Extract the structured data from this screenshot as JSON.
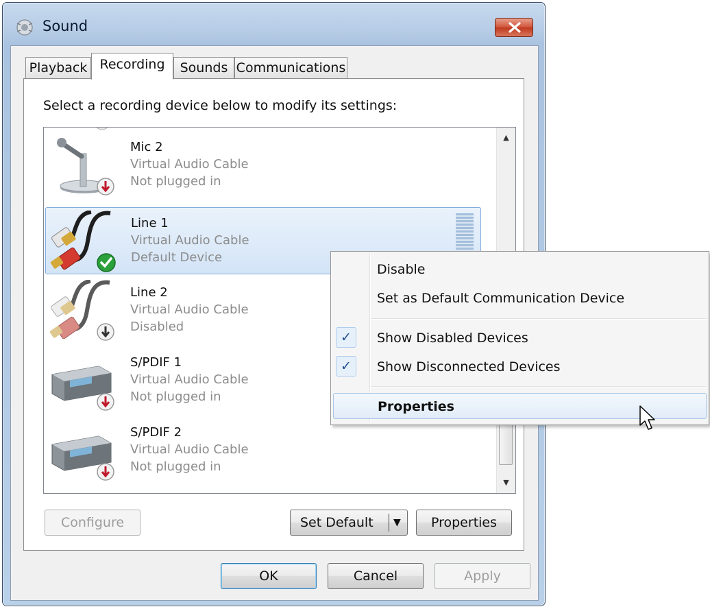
{
  "window": {
    "title": "Sound"
  },
  "tabs": [
    {
      "label": "Playback"
    },
    {
      "label": "Recording"
    },
    {
      "label": "Sounds"
    },
    {
      "label": "Communications"
    }
  ],
  "active_tab": "Recording",
  "instruction": "Select a recording device below to modify its settings:",
  "devices": [
    {
      "name": "Mic 2",
      "driver": "Virtual Audio Cable",
      "status": "Not plugged in",
      "icon": "microphone-icon",
      "badge": "red-down-arrow"
    },
    {
      "name": "Line 1",
      "driver": "Virtual Audio Cable",
      "status": "Default Device",
      "icon": "line-in-cable-icon",
      "badge": "green-check",
      "selected": true
    },
    {
      "name": "Line 2",
      "driver": "Virtual Audio Cable",
      "status": "Disabled",
      "icon": "line-in-cable-icon",
      "badge": "gray-down-arrow"
    },
    {
      "name": "S/PDIF 1",
      "driver": "Virtual Audio Cable",
      "status": "Not plugged in",
      "icon": "spdif-device-icon",
      "badge": "red-down-arrow"
    },
    {
      "name": "S/PDIF 2",
      "driver": "Virtual Audio Cable",
      "status": "Not plugged in",
      "icon": "spdif-device-icon",
      "badge": "red-down-arrow"
    }
  ],
  "panel_buttons": {
    "configure": "Configure",
    "set_default": "Set Default",
    "properties": "Properties"
  },
  "dialog_buttons": {
    "ok": "OK",
    "cancel": "Cancel",
    "apply": "Apply"
  },
  "context_menu": {
    "items": [
      {
        "label": "Disable"
      },
      {
        "label": "Set as Default Communication Device"
      },
      {
        "label": "Show Disabled Devices",
        "checked": true
      },
      {
        "label": "Show Disconnected Devices",
        "checked": true
      },
      {
        "label": "Properties",
        "bold": true,
        "highlighted": true
      }
    ],
    "check_glyph": "✓"
  },
  "colors": {
    "selection": "#d3e4f7",
    "close_button": "#c94a2e",
    "check": "#1c4b8d"
  }
}
